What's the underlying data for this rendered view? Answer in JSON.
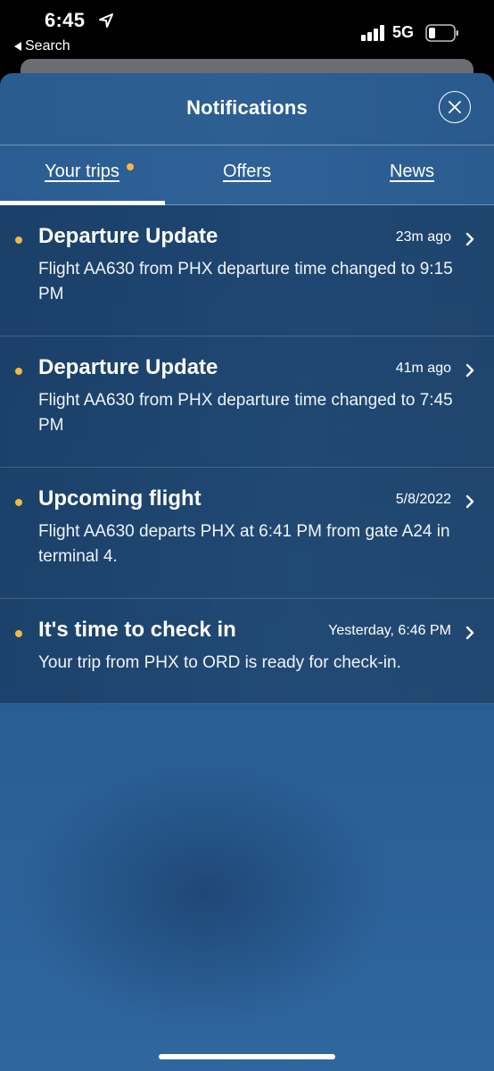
{
  "status_bar": {
    "time": "6:45",
    "back_label": "Search",
    "network": "5G"
  },
  "sheet": {
    "title": "Notifications"
  },
  "tabs": [
    {
      "label": "Your trips",
      "has_dot": true,
      "active": true
    },
    {
      "label": "Offers",
      "has_dot": false,
      "active": false
    },
    {
      "label": "News",
      "has_dot": false,
      "active": false
    }
  ],
  "notifications": [
    {
      "title": "Departure Update",
      "time": "23m ago",
      "body": "Flight AA630 from PHX departure time changed to 9:15 PM",
      "unread": true
    },
    {
      "title": "Departure Update",
      "time": "41m ago",
      "body": "Flight AA630 from PHX departure time changed to 7:45 PM",
      "unread": true
    },
    {
      "title": "Upcoming flight",
      "time": "5/8/2022",
      "body": "Flight AA630 departs PHX at 6:41 PM from gate A24 in terminal 4.",
      "unread": true
    },
    {
      "title": "It's time to check in",
      "time": "Yesterday, 6:46 PM",
      "body": "Your trip from PHX to ORD is ready for check-in.",
      "unread": true
    }
  ],
  "colors": {
    "unread_dot": "#f3b944",
    "sheet_blue": "#245689"
  },
  "icons": {
    "location": "location-arrow-icon",
    "close": "close-icon",
    "chevron": "chevron-right-icon"
  }
}
